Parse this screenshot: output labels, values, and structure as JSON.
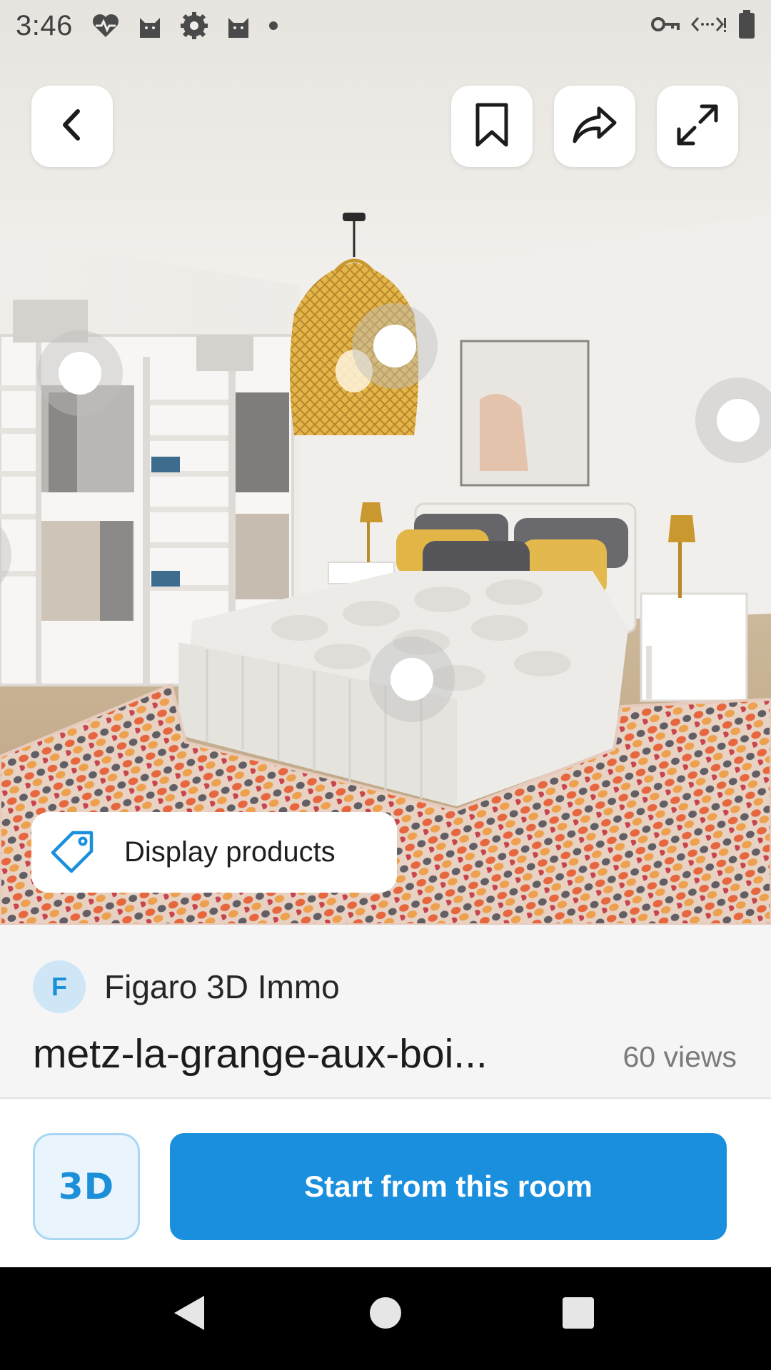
{
  "status_bar": {
    "time": "3:46",
    "left_icons": [
      "heart-monitor-icon",
      "cat-icon",
      "cog-badge-icon",
      "cat-icon",
      "dot-icon"
    ],
    "right_icons": [
      "vpn-key-icon",
      "data-transfer-icon",
      "battery-icon"
    ]
  },
  "toolbar": {
    "back_icon": "chevron-left-icon",
    "bookmark_icon": "bookmark-icon",
    "share_icon": "share-icon",
    "fullscreen_icon": "expand-icon"
  },
  "scene": {
    "display_products_label": "Display products",
    "hotspot_count": 5
  },
  "room": {
    "author_initial": "F",
    "author_name": "Figaro 3D Immo",
    "title": "metz-la-grange-aux-boi...",
    "views": "60 views"
  },
  "actions": {
    "mode_label": "3D",
    "start_label": "Start from this room"
  },
  "nav_bar": {
    "back_icon": "triangle-back-icon",
    "home_icon": "circle-home-icon",
    "recents_icon": "square-recents-icon"
  },
  "colors": {
    "accent": "#1a8fdd",
    "accent_light": "#e9f4fc",
    "panel_bg": "#f5f5f5"
  }
}
